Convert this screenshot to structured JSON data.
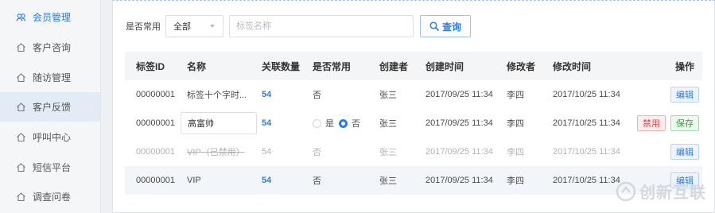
{
  "sidebar": {
    "items": [
      {
        "label": "会员管理",
        "icon": "users-icon",
        "active": true
      },
      {
        "label": "客户咨询",
        "icon": "home-icon"
      },
      {
        "label": "随访管理",
        "icon": "home-icon"
      },
      {
        "label": "客户反馈",
        "icon": "home-icon",
        "selected": true
      },
      {
        "label": "呼叫中心",
        "icon": "home-icon"
      },
      {
        "label": "短信平台",
        "icon": "home-icon"
      },
      {
        "label": "调查问卷",
        "icon": "home-icon"
      }
    ]
  },
  "filter": {
    "common_label": "是否常用",
    "common_value": "全部",
    "search_placeholder": "标签名称",
    "query_label": "查询"
  },
  "table": {
    "headers": {
      "id": "标签ID",
      "name": "名称",
      "count": "关联数量",
      "common": "是否常用",
      "creator": "创建者",
      "ctime": "创建时间",
      "modifier": "修改者",
      "mtime": "修改时间",
      "ops": "操作"
    },
    "rows": [
      {
        "id": "00000001",
        "name": "标签十个字时...",
        "count": "54",
        "common": "否",
        "creator": "张三",
        "ctime": "2017/09/25 11:34",
        "modifier": "李四",
        "mtime": "2017/10/25 11:34",
        "edit": "编辑"
      },
      {
        "id": "00000001",
        "name": "高富帅",
        "count": "54",
        "common_yes": "是",
        "common_no": "否",
        "creator": "张三",
        "ctime": "2017/09/25 11:34",
        "modifier": "李四",
        "mtime": "2017/10/25 11:34",
        "disable": "禁用",
        "save": "保存"
      },
      {
        "id": "00000001",
        "name": "VIP（已禁用）",
        "count": "54",
        "common": "否",
        "creator": "张三",
        "ctime": "2017/09/25 11:34",
        "modifier": "李四",
        "mtime": "2017/10/25 11:34",
        "edit": "编辑"
      },
      {
        "id": "00000001",
        "name": "VIP",
        "count": "54",
        "common": "否",
        "creator": "张三",
        "ctime": "2017/09/25 11:34",
        "modifier": "李四",
        "mtime": "2017/10/25 11:34",
        "edit": "编辑"
      }
    ]
  },
  "watermark": {
    "text": "创新互联"
  },
  "colors": {
    "accent": "#2a7de1",
    "danger": "#e0464d",
    "success": "#3aa14a",
    "sidebar_bg": "#f5f6f8",
    "selected_bg": "#e2ebf6"
  }
}
